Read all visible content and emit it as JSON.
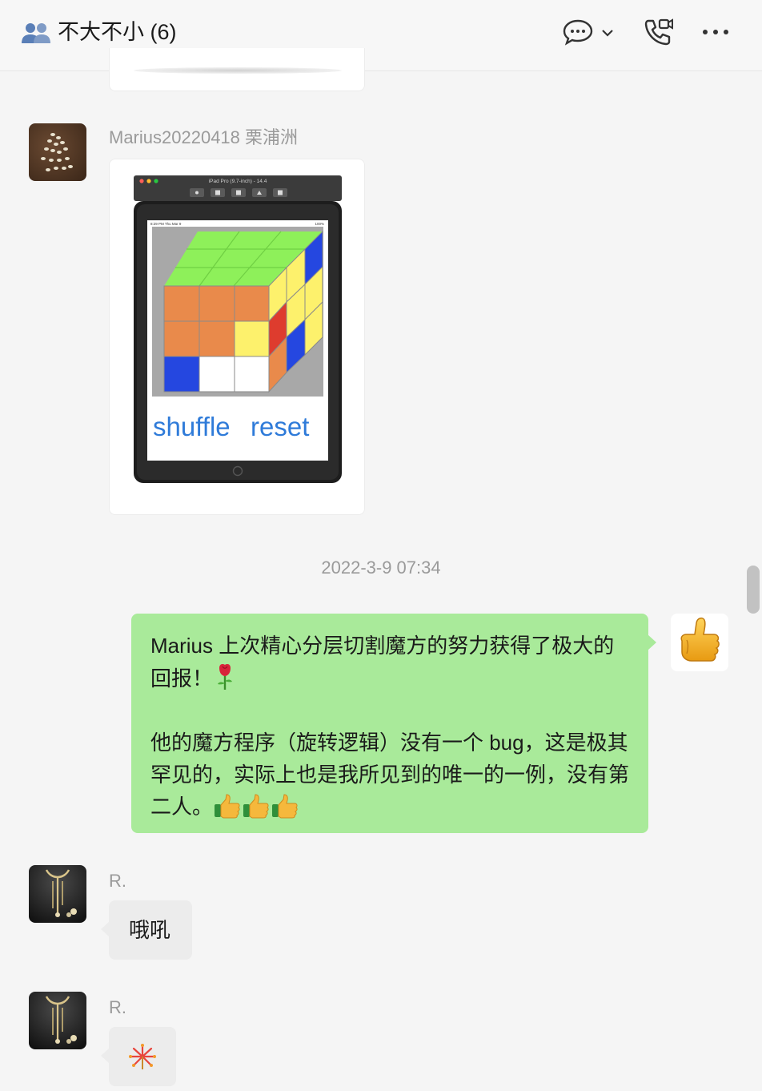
{
  "header": {
    "title": "不大不小 (6)",
    "icons": [
      "group-icon",
      "chat-bubble-icon",
      "chevron-down-icon",
      "video-call-icon",
      "more-icon"
    ]
  },
  "messages": {
    "marius": {
      "sender": "Marius20220418 栗浦洲",
      "screenshot": {
        "window_title": "iPad Pro (9.7-inch) - 14.4",
        "status_left": "8:29 PM  Thu Mar 9",
        "status_right": "100%",
        "shuffle_label": "shuffle",
        "reset_label": "reset"
      }
    },
    "timestamp": "2022-3-9 07:34",
    "self": {
      "line1": "Marius 上次精心分层切割魔方的努力获得了极大的回报！",
      "line2": "他的魔方程序（旋转逻辑）没有一个 bug，这是极其罕见的，实际上也是我所见到的唯一的一例，没有第二人。"
    },
    "r1": {
      "sender": "R.",
      "text": "哦吼"
    },
    "r2": {
      "sender": "R.",
      "emoji": "fireworks"
    }
  },
  "colors": {
    "self_bubble": "#a9ea9a",
    "other_bubble": "#ececec",
    "cube_top": "#8ef05a",
    "cube_orange": "#e98a4b",
    "cube_yellow": "#fdf16c",
    "cube_blue": "#2547e0",
    "cube_red": "#de3c2e",
    "button_blue": "#2f7bd9"
  }
}
